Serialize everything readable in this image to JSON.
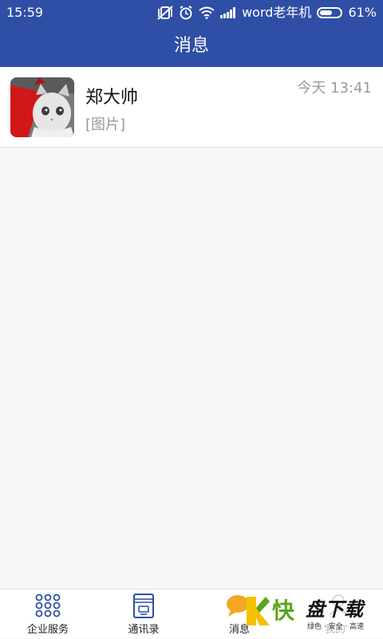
{
  "status_bar": {
    "time": "15:59",
    "carrier": "word老年机",
    "battery": "61%",
    "battery_level": 0.61
  },
  "header": {
    "title": "消息"
  },
  "messages": [
    {
      "name": "郑大帅",
      "preview": "[图片]",
      "time": "今天 13:41"
    }
  ],
  "bottom_nav": [
    {
      "label": "企业服务",
      "icon": "grid-icon"
    },
    {
      "label": "通讯录",
      "icon": "contacts-book-icon"
    },
    {
      "label": "消息",
      "icon": "chat-bubble-icon"
    },
    {
      "label": "我的",
      "icon": "profile-icon"
    }
  ],
  "watermark": {
    "brand": "快",
    "name": "盘下载",
    "slogan": "绿色 · 安全 · 高速"
  },
  "colors": {
    "primary": "#2f4ea5",
    "accent": "#f5a623"
  }
}
